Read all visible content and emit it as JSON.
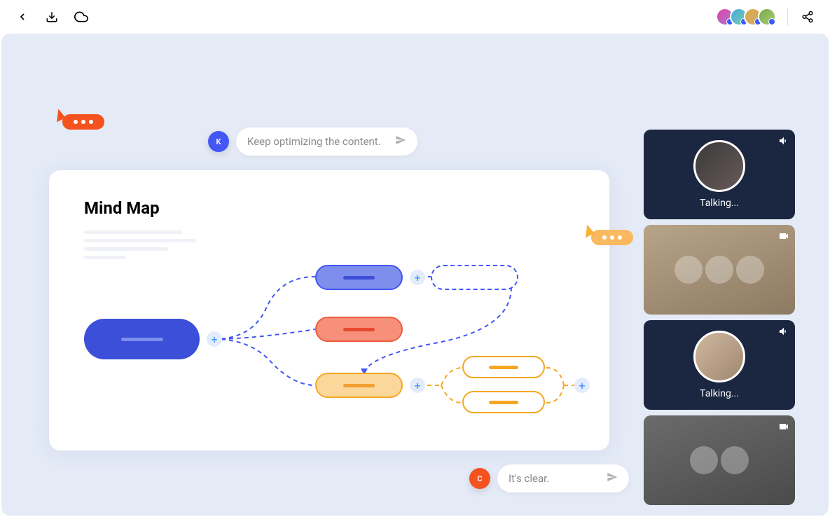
{
  "topbar": {
    "icons": [
      "back",
      "download",
      "cloud"
    ],
    "share_icon": "share"
  },
  "cursors": {
    "orange": {
      "color": "#f4521e"
    },
    "yellow": {
      "color": "#f9b960"
    }
  },
  "comments": [
    {
      "avatar_letter": "K",
      "avatar_color": "#4457f6",
      "text": "Keep optimizing the content."
    },
    {
      "avatar_letter": "C",
      "avatar_color": "#f4521e",
      "text": "It's clear."
    }
  ],
  "canvas": {
    "title": "Mind Map"
  },
  "video": {
    "tiles": [
      {
        "type": "dark",
        "status": "Talking...",
        "icon": "audio"
      },
      {
        "type": "photo",
        "icon": "video"
      },
      {
        "type": "dark",
        "status": "Talking...",
        "icon": "audio"
      },
      {
        "type": "photo",
        "icon": "video"
      }
    ]
  }
}
